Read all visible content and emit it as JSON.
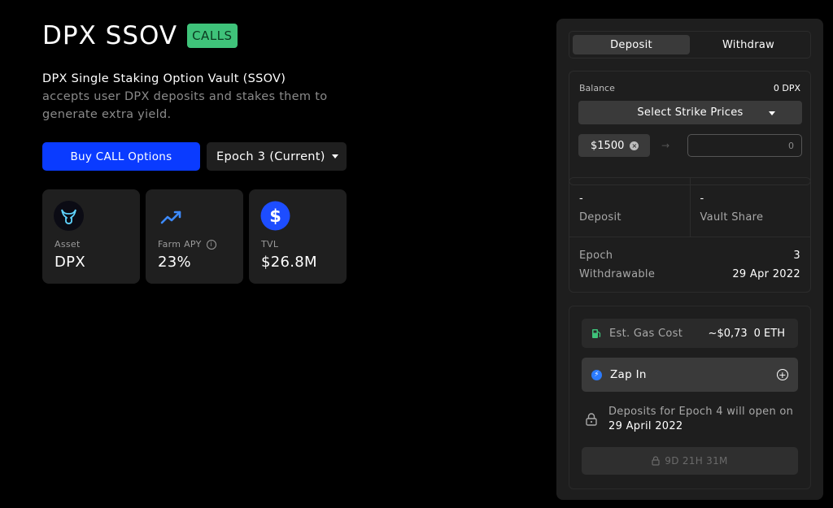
{
  "header": {
    "title": "DPX SSOV",
    "badge": "CALLS",
    "description_lead": "DPX Single Staking Option Vault (SSOV)",
    "description_rest": "accepts user DPX deposits and stakes them to generate extra yield."
  },
  "actions": {
    "buy_label": "Buy CALL Options",
    "epoch_label": "Epoch 3 (Current)"
  },
  "stats": [
    {
      "icon": "dpx-token-icon",
      "label": "Asset",
      "value": "DPX"
    },
    {
      "icon": "trending-up-icon",
      "label": "Farm APY",
      "value": "23%"
    },
    {
      "icon": "dollar-icon",
      "label": "TVL",
      "value": "$26.8M"
    }
  ],
  "panel": {
    "tabs": [
      "Deposit",
      "Withdraw"
    ],
    "active_tab": "Deposit",
    "balance_label": "Balance",
    "balance_value": "0 DPX",
    "strike_select_label": "Select Strike Prices",
    "strike_chip": "$1500",
    "amount_placeholder": "0",
    "deposit_value": "-",
    "deposit_label": "Deposit",
    "vault_share_value": "-",
    "vault_share_label": "Vault Share",
    "epoch_label": "Epoch",
    "epoch_value": "3",
    "withdrawable_label": "Withdrawable",
    "withdrawable_value": "29 Apr 2022",
    "gas_label": "Est. Gas Cost",
    "gas_usd": "~$0,73",
    "gas_eth": "0 ETH",
    "zap_label": "Zap In",
    "notice_a": "Deposits for Epoch 4 will open on",
    "notice_b": "29 April 2022",
    "countdown": "9D 21H 31M"
  },
  "colors": {
    "accent_blue": "#0a3bff",
    "badge_green": "#3fc37a",
    "card_bg": "#1f1f1f",
    "panel_bg": "#1e1e1e"
  }
}
